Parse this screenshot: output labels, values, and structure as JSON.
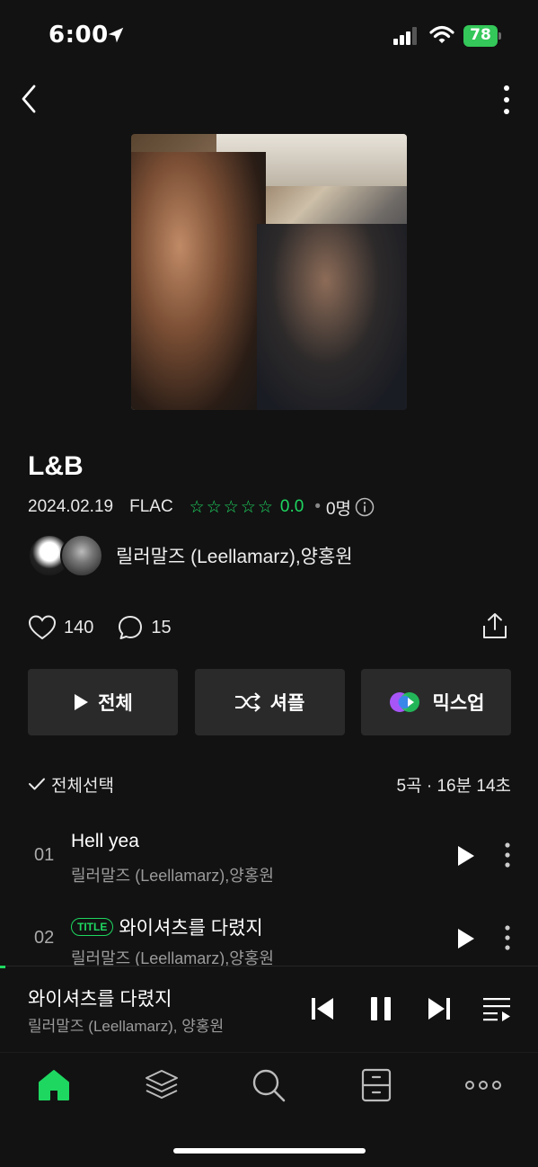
{
  "status_bar": {
    "time": "6:00",
    "battery": "78"
  },
  "album": {
    "title": "L&B",
    "date": "2024.02.19",
    "format": "FLAC",
    "rating": "0.0",
    "rating_count": "0명",
    "artists": "릴러말즈 (Leellamarz),양홍원"
  },
  "social": {
    "likes": "140",
    "comments": "15"
  },
  "buttons": {
    "play_all": "전체",
    "shuffle": "셔플",
    "mixup": "믹스업"
  },
  "list_header": {
    "select_all": "전체선택",
    "summary": "5곡 · 16분 14초"
  },
  "tracks": [
    {
      "num": "01",
      "title": "Hell yea",
      "artist": "릴러말즈 (Leellamarz),양홍원",
      "badge": ""
    },
    {
      "num": "02",
      "title": "와이셔츠를 다렸지",
      "artist": "릴러말즈 (Leellamarz),양홍원",
      "badge": "TITLE"
    }
  ],
  "now_playing": {
    "title": "와이셔츠를 다렸지",
    "artist": "릴러말즈 (Leellamarz), 양홍원",
    "progress": 0.01
  },
  "colors": {
    "accent": "#1ed760",
    "background": "#121212",
    "button_bg": "#2a2a2a"
  }
}
